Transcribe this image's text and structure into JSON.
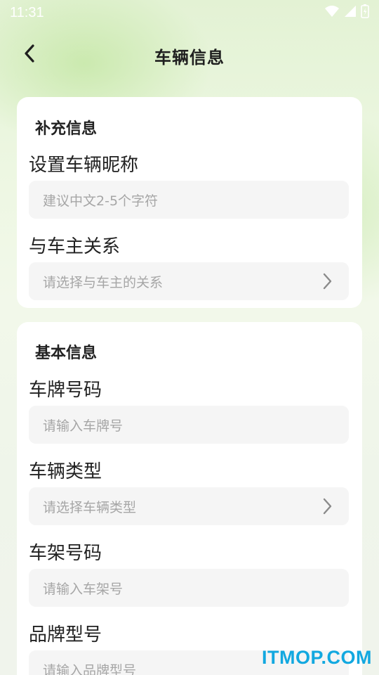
{
  "status_bar": {
    "time": "11:31"
  },
  "nav": {
    "title": "车辆信息"
  },
  "supplement": {
    "title": "补充信息",
    "nickname": {
      "label": "设置车辆昵称",
      "placeholder": "建议中文2-5个字符"
    },
    "relation": {
      "label": "与车主关系",
      "placeholder": "请选择与车主的关系"
    }
  },
  "basic": {
    "title": "基本信息",
    "plate": {
      "label": "车牌号码",
      "placeholder": "请输入车牌号"
    },
    "vehicle_type": {
      "label": "车辆类型",
      "placeholder": "请选择车辆类型"
    },
    "frame": {
      "label": "车架号码",
      "placeholder": "请输入车架号"
    },
    "brand": {
      "label": "品牌型号",
      "placeholder": "请输入品牌型号"
    }
  },
  "watermark": "ITMOP.COM",
  "colors": {
    "accent_watermark": "#12a8e0",
    "field_bg": "#f5f5f5",
    "placeholder": "#a6a6a6"
  },
  "icons": [
    "back-arrow-icon",
    "chevron-right-icon",
    "wifi-icon",
    "signal-icon",
    "battery-icon"
  ]
}
